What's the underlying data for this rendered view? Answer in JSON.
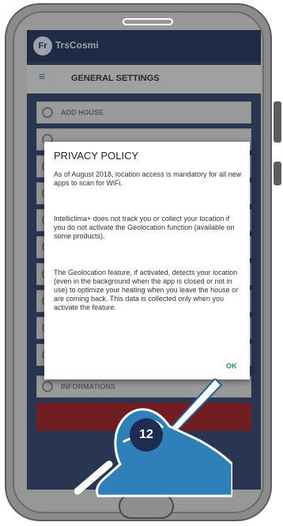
{
  "app": {
    "brand": "TrsCosmi",
    "logo_text": "Fr"
  },
  "header": {
    "icon_label": "≡",
    "title": "GENERAL SETTINGS"
  },
  "menu": {
    "items": [
      {
        "label": "ADD HOUSE"
      },
      {
        "label": ""
      },
      {
        "label": ""
      },
      {
        "label": ""
      },
      {
        "label": ""
      },
      {
        "label": ""
      },
      {
        "label": ""
      },
      {
        "label": ""
      },
      {
        "label": ""
      },
      {
        "label": ""
      },
      {
        "label": "INFORMATIONS"
      }
    ]
  },
  "dialog": {
    "title": "PRIVACY POLICY",
    "p1": "As of August 2018, location access is mandatory for all new apps to scan for WiFi.",
    "p2": "Intelliclima+ does not track you or collect your location if you do not activate the Geolocation function (available on some products).",
    "p3": "The Geolocation feature, if activated, detects your location (even in the background when the app is closed or not in use) to optimize your heating when you leave the house or are coming back. This data is collected only when you activate the feature.",
    "ok_label": "OK"
  },
  "step": {
    "number": "12"
  },
  "colors": {
    "topbar": "#1d2c50",
    "screen": "#2a3c63",
    "button_red": "#8e1b22",
    "ok_green": "#2e8b57",
    "hand_blue": "#2f7fb8"
  }
}
